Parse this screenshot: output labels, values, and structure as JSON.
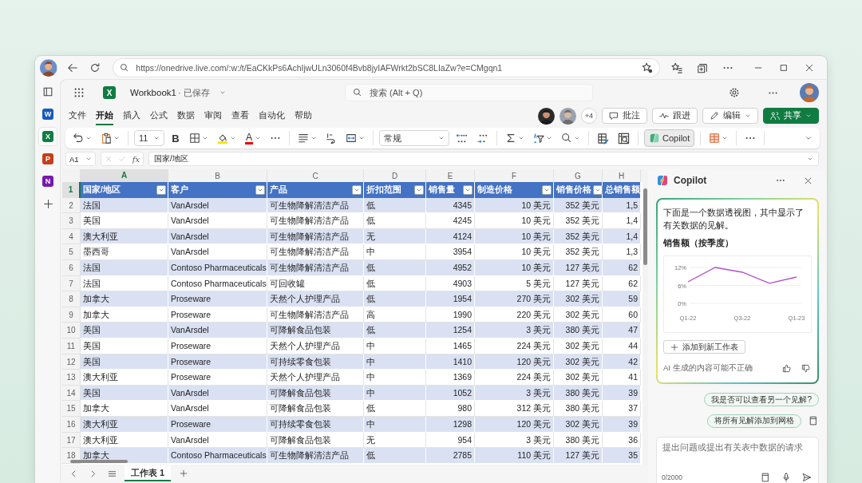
{
  "browser": {
    "url": "https://onedrive.live.com/:w:/t/EaCKkPs6AchIjwULn3060f4Bvb8jyIAFWrkt2bSC8LIaZw?e=CMgqn1"
  },
  "rail_apps": [
    {
      "letter": "W",
      "color": "#185abd",
      "selected": false
    },
    {
      "letter": "X",
      "color": "#107c41",
      "selected": true
    },
    {
      "letter": "P",
      "color": "#c43e1c",
      "selected": false
    },
    {
      "letter": "N",
      "color": "#7719aa",
      "selected": false
    }
  ],
  "app": {
    "logo": "X",
    "title": "Workbook1",
    "status": "· 已保存",
    "search_placeholder": "搜索 (Alt + Q)"
  },
  "menu": [
    {
      "label": "文件",
      "selected": false
    },
    {
      "label": "开始",
      "selected": true
    },
    {
      "label": "插入",
      "selected": false
    },
    {
      "label": "公式",
      "selected": false
    },
    {
      "label": "数据",
      "selected": false
    },
    {
      "label": "审阅",
      "selected": false
    },
    {
      "label": "查看",
      "selected": false
    },
    {
      "label": "自动化",
      "selected": false
    },
    {
      "label": "帮助",
      "selected": false
    }
  ],
  "presence": {
    "more": "+4"
  },
  "actions": [
    {
      "kind": "comment",
      "label": "批注"
    },
    {
      "kind": "catchup",
      "label": "跟进"
    },
    {
      "kind": "edit",
      "label": "编辑"
    },
    {
      "kind": "share",
      "label": "共享"
    }
  ],
  "ribbon": {
    "font_size": "11",
    "bold": "B",
    "font_color": "A",
    "number_format": "常规",
    "copilot": {
      "label": "Copilot",
      "selected": true
    }
  },
  "formula_bar": {
    "name_box": "A1",
    "fx": "fx",
    "content": "国家/地区"
  },
  "sheet": {
    "columns": [
      {
        "letter": "A",
        "selected": true
      },
      {
        "letter": "B",
        "selected": false
      },
      {
        "letter": "C",
        "selected": false
      },
      {
        "letter": "D",
        "selected": false
      },
      {
        "letter": "E",
        "selected": false
      },
      {
        "letter": "F",
        "selected": false
      },
      {
        "letter": "G",
        "selected": false
      },
      {
        "letter": "H",
        "selected": false
      }
    ],
    "header_row": "1",
    "headers": [
      {
        "label": "国家/地区",
        "filter": true
      },
      {
        "label": "客户",
        "filter": true
      },
      {
        "label": "产品",
        "filter": true
      },
      {
        "label": "折扣范围",
        "filter": true
      },
      {
        "label": "销售量",
        "filter": true
      },
      {
        "label": "制造价格",
        "filter": true
      },
      {
        "label": "销售价格",
        "filter": true
      },
      {
        "label": "总销售额"
      }
    ],
    "rows": [
      {
        "n": "2",
        "cells": [
          "法国",
          "VanArsdel",
          "可生物降解清洁产品",
          "低",
          "4345",
          "10 美元",
          "352 美元",
          "1,5"
        ]
      },
      {
        "n": "3",
        "cells": [
          "美国",
          "VanArsdel",
          "可生物降解清洁产品",
          "低",
          "4245",
          "10 美元",
          "352 美元",
          "1,4"
        ]
      },
      {
        "n": "4",
        "cells": [
          "澳大利亚",
          "VanArsdel",
          "可生物降解清洁产品",
          "无",
          "4124",
          "10 美元",
          "352 美元",
          "1,4"
        ]
      },
      {
        "n": "5",
        "cells": [
          "墨西哥",
          "VanArsdel",
          "可生物降解清洁产品",
          "中",
          "3954",
          "10 美元",
          "352 美元",
          "1,3"
        ]
      },
      {
        "n": "6",
        "cells": [
          "法国",
          "Contoso Pharmaceuticals",
          "可生物降解清洁产品",
          "低",
          "4952",
          "10 美元",
          "127 美元",
          "62"
        ]
      },
      {
        "n": "7",
        "cells": [
          "法国",
          "Contoso Pharmaceuticals",
          "可回收罐",
          "低",
          "4903",
          "5 美元",
          "127 美元",
          "62"
        ]
      },
      {
        "n": "8",
        "cells": [
          "加拿大",
          "Proseware",
          "天然个人护理产品",
          "低",
          "1954",
          "270 美元",
          "302 美元",
          "59"
        ]
      },
      {
        "n": "9",
        "cells": [
          "加拿大",
          "Proseware",
          "可生物降解清洁产品",
          "高",
          "1990",
          "220 美元",
          "302 美元",
          "60"
        ]
      },
      {
        "n": "10",
        "cells": [
          "美国",
          "VanArsdel",
          "可降解食品包装",
          "低",
          "1254",
          "3 美元",
          "380 美元",
          "47"
        ]
      },
      {
        "n": "11",
        "cells": [
          "美国",
          "Proseware",
          "天然个人护理产品",
          "中",
          "1465",
          "224 美元",
          "302 美元",
          "44"
        ]
      },
      {
        "n": "12",
        "cells": [
          "美国",
          "Proseware",
          "可持续零食包装",
          "中",
          "1410",
          "120 美元",
          "302 美元",
          "42"
        ]
      },
      {
        "n": "13",
        "cells": [
          "澳大利亚",
          "Proseware",
          "天然个人护理产品",
          "中",
          "1369",
          "224 美元",
          "302 美元",
          "41"
        ]
      },
      {
        "n": "14",
        "cells": [
          "美国",
          "VanArsdel",
          "可降解食品包装",
          "中",
          "1052",
          "3 美元",
          "380 美元",
          "39"
        ]
      },
      {
        "n": "15",
        "cells": [
          "加拿大",
          "VanArsdel",
          "可降解食品包装",
          "低",
          "980",
          "312 美元",
          "380 美元",
          "37"
        ]
      },
      {
        "n": "16",
        "cells": [
          "澳大利亚",
          "Proseware",
          "可持续零食包装",
          "中",
          "1298",
          "120 美元",
          "302 美元",
          "39"
        ]
      },
      {
        "n": "17",
        "cells": [
          "澳大利亚",
          "VanArsdel",
          "可降解食品包装",
          "无",
          "954",
          "3 美元",
          "380 美元",
          "36"
        ]
      },
      {
        "n": "18",
        "cells": [
          "加拿大",
          "Contoso Pharmaceuticals",
          "可生物降解清洁产品",
          "低",
          "2785",
          "110 美元",
          "127 美元",
          "35"
        ]
      }
    ]
  },
  "sheet_tabs": [
    {
      "label": "工作表 1",
      "selected": true
    }
  ],
  "copilot": {
    "title": "Copilot",
    "message": "下面是一个数据透视图，其中显示了有关数据的见解。",
    "chart_data": {
      "type": "line",
      "title": "销售额（按季度）",
      "categories": [
        "Q1-22",
        null,
        "Q3-22",
        null,
        "Q1-23"
      ],
      "yticks": [
        {
          "value": 0,
          "label": "0%"
        },
        {
          "value": 6,
          "label": "6%"
        },
        {
          "value": 12,
          "label": "12%"
        }
      ],
      "ylim": [
        0,
        12
      ],
      "series": [
        {
          "color": "#b04fc8",
          "values": [
            7.2,
            12,
            10.4,
            6.7,
            8.8
          ]
        }
      ]
    },
    "add_button": "添加到新工作表",
    "disclaimer": "AI 生成的内容可能不正确",
    "suggestions": [
      "我是否可以查看另一个见解?",
      "将所有见解添加到网格"
    ],
    "input_placeholder": "提出问题或提出有关表中数据的请求",
    "counter": "0/2000"
  }
}
